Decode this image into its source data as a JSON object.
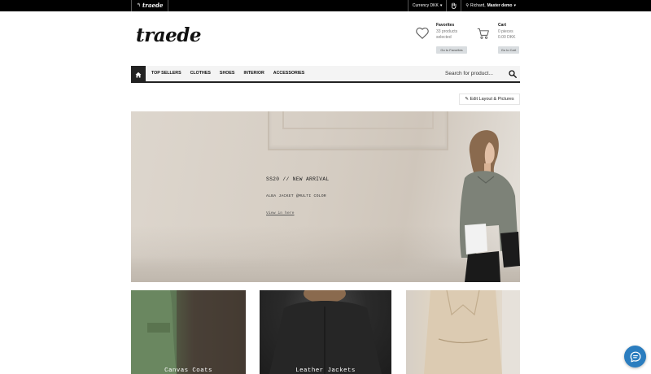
{
  "topbar": {
    "back_label": "traede",
    "currency_label": "Currency DKK",
    "user_prefix": "Richard,",
    "user_name": "Master demo"
  },
  "header": {
    "logo": "traede",
    "favorites": {
      "title": "Favorites",
      "line1": "33 products",
      "line2": "selected",
      "button": "Go to Favorites"
    },
    "cart": {
      "title": "Cart",
      "line1": "0 pieces",
      "line2": "0.00 DKK",
      "button": "Go to Cart"
    }
  },
  "nav": {
    "items": [
      {
        "label": "TOP SELLERS"
      },
      {
        "label": "CLOTHES"
      },
      {
        "label": "SHOES"
      },
      {
        "label": "INTERIOR"
      },
      {
        "label": "ACCESSORIES"
      }
    ],
    "search_placeholder": "Search for product..."
  },
  "edit_button": "Edit Layout & Pictures",
  "hero": {
    "title": "SS20 // NEW ARRIVAL",
    "subtitle": "ALBA JACKET @MULTI COLOR",
    "link": "View in here"
  },
  "categories": [
    {
      "label": "Canvas Coats"
    },
    {
      "label": "Leather Jackets"
    },
    {
      "label": ""
    }
  ],
  "colors": {
    "topbar": "#000000",
    "accent_chat": "#2b7dbf",
    "nav_bg": "#f4f4f4"
  }
}
